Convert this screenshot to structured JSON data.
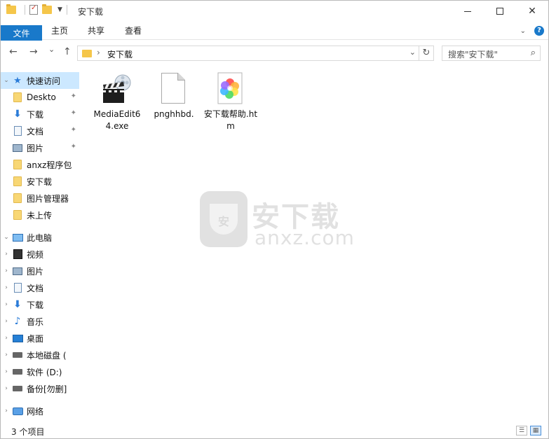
{
  "window": {
    "title": "安下载"
  },
  "ribbon": {
    "tabs": [
      {
        "label": "文件"
      },
      {
        "label": "主页"
      },
      {
        "label": "共享"
      },
      {
        "label": "查看"
      }
    ],
    "help_label": "?"
  },
  "nav": {
    "back": "←",
    "forward": "→",
    "recent": "⌄",
    "up": "↑",
    "address": {
      "crumb_sep": "›",
      "current": "安下载",
      "dropdown": "⌄"
    },
    "refresh": "↻",
    "search": {
      "placeholder": "搜索\"安下载\"",
      "icon": "⌕"
    }
  },
  "sidebar": {
    "items": [
      {
        "label": "快速访问",
        "icon": "star-icon",
        "expander": "⌄",
        "selected": true
      },
      {
        "label": "Deskto",
        "icon": "folder-icon",
        "pinned": true
      },
      {
        "label": "下载",
        "icon": "download-icon",
        "pinned": true
      },
      {
        "label": "文档",
        "icon": "document-icon",
        "pinned": true
      },
      {
        "label": "图片",
        "icon": "picture-icon",
        "pinned": true
      },
      {
        "label": "anxz程序包",
        "icon": "folder-icon"
      },
      {
        "label": "安下载",
        "icon": "folder-icon"
      },
      {
        "label": "图片管理器",
        "icon": "folder-icon"
      },
      {
        "label": "未上传",
        "icon": "folder-icon"
      },
      {
        "label": "此电脑",
        "icon": "computer-icon",
        "expander": "⌄"
      },
      {
        "label": "视频",
        "icon": "video-icon",
        "expander": "›"
      },
      {
        "label": "图片",
        "icon": "picture-icon",
        "expander": "›"
      },
      {
        "label": "文档",
        "icon": "document-icon",
        "expander": "›"
      },
      {
        "label": "下载",
        "icon": "download-icon",
        "expander": "›"
      },
      {
        "label": "音乐",
        "icon": "music-icon",
        "expander": "›"
      },
      {
        "label": "桌面",
        "icon": "desktop-icon",
        "expander": "›"
      },
      {
        "label": "本地磁盘 (",
        "icon": "disk-icon",
        "expander": "›"
      },
      {
        "label": "软件 (D:)",
        "icon": "disk-icon",
        "expander": "›"
      },
      {
        "label": "备份[勿删]",
        "icon": "disk-icon",
        "expander": "›"
      },
      {
        "label": "网络",
        "icon": "network-icon",
        "expander": "›"
      }
    ],
    "pin_glyph": "📌"
  },
  "files": [
    {
      "name": "MediaEdit64.exe",
      "icon": "media-editor-exe-icon"
    },
    {
      "name": "pnghhbd.",
      "icon": "blank-file-icon"
    },
    {
      "name": "安下载帮助.htm",
      "icon": "html-file-icon"
    }
  ],
  "watermark": {
    "cn": "安下载",
    "en": "anxz.com",
    "badge": "安"
  },
  "status": {
    "count_text": "3 个项目"
  }
}
